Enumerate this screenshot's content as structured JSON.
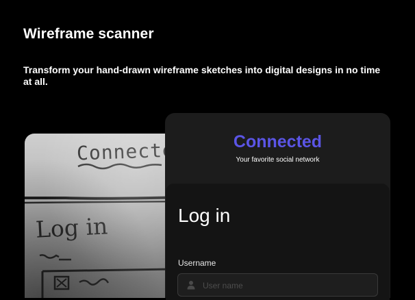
{
  "header": {
    "title": "Wireframe scanner",
    "subtitle": "Transform your hand-drawn wireframe sketches into digital designs in no time at all."
  },
  "sketch": {
    "word": "Connecte",
    "login": "Log in"
  },
  "app": {
    "brand": "Connected",
    "tagline": "Your favorite social network",
    "login_heading": "Log in",
    "username_label": "Username",
    "username_placeholder": "User name",
    "username_value": ""
  },
  "colors": {
    "background": "#000000",
    "card": "#1c1c1c",
    "panel": "#141414",
    "brand": "#5b55e6"
  },
  "icons": {
    "username_field": "user-icon"
  }
}
